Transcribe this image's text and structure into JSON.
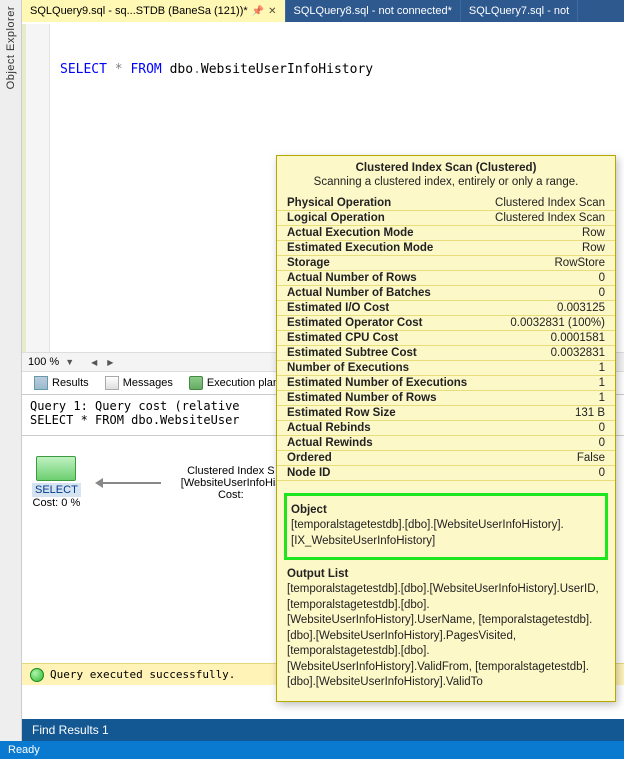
{
  "sidebar": {
    "object_explorer": "Object Explorer"
  },
  "tabs": [
    {
      "label": "SQLQuery9.sql - sq...STDB (BaneSa (121))*",
      "active": true
    },
    {
      "label": "SQLQuery8.sql - not connected*",
      "active": false
    },
    {
      "label": "SQLQuery7.sql - not",
      "active": false
    }
  ],
  "sql": {
    "select": "SELECT",
    "star": " * ",
    "from": "FROM",
    "space": " ",
    "schema": "dbo",
    "dot": ".",
    "object": "WebsiteUserInfoHistory"
  },
  "zoom": {
    "value": "100 %"
  },
  "result_tabs": {
    "results": "Results",
    "messages": "Messages",
    "plan": "Execution plan"
  },
  "plan": {
    "line1": "Query 1: Query cost (relative",
    "line2": "SELECT * FROM dbo.WebsiteUser",
    "select_label": "SELECT",
    "select_cost": "Cost: 0 %",
    "scan_l1": "Clustered Index S",
    "scan_l2": "[WebsiteUserInfoHis",
    "scan_cost": "Cost:"
  },
  "status": {
    "text": "Query executed successfully."
  },
  "find_results": "Find Results 1",
  "ready": "Ready",
  "tooltip": {
    "title": "Clustered Index Scan (Clustered)",
    "subtitle": "Scanning a clustered index, entirely or only a range.",
    "rows": [
      {
        "k": "Physical Operation",
        "v": "Clustered Index Scan"
      },
      {
        "k": "Logical Operation",
        "v": "Clustered Index Scan"
      },
      {
        "k": "Actual Execution Mode",
        "v": "Row"
      },
      {
        "k": "Estimated Execution Mode",
        "v": "Row"
      },
      {
        "k": "Storage",
        "v": "RowStore"
      },
      {
        "k": "Actual Number of Rows",
        "v": "0"
      },
      {
        "k": "Actual Number of Batches",
        "v": "0"
      },
      {
        "k": "Estimated I/O Cost",
        "v": "0.003125"
      },
      {
        "k": "Estimated Operator Cost",
        "v": "0.0032831 (100%)"
      },
      {
        "k": "Estimated CPU Cost",
        "v": "0.0001581"
      },
      {
        "k": "Estimated Subtree Cost",
        "v": "0.0032831"
      },
      {
        "k": "Number of Executions",
        "v": "1"
      },
      {
        "k": "Estimated Number of Executions",
        "v": "1"
      },
      {
        "k": "Estimated Number of Rows",
        "v": "1"
      },
      {
        "k": "Estimated Row Size",
        "v": "131 B"
      },
      {
        "k": "Actual Rebinds",
        "v": "0"
      },
      {
        "k": "Actual Rewinds",
        "v": "0"
      },
      {
        "k": "Ordered",
        "v": "False"
      },
      {
        "k": "Node ID",
        "v": "0"
      }
    ],
    "object_label": "Object",
    "object_text": "[temporalstagetestdb].[dbo].[WebsiteUserInfoHistory].[IX_WebsiteUserInfoHistory]",
    "output_label": "Output List",
    "output_text": "[temporalstagetestdb].[dbo].[WebsiteUserInfoHistory].UserID, [temporalstagetestdb].[dbo].[WebsiteUserInfoHistory].UserName, [temporalstagetestdb].[dbo].[WebsiteUserInfoHistory].PagesVisited, [temporalstagetestdb].[dbo].[WebsiteUserInfoHistory].ValidFrom, [temporalstagetestdb].[dbo].[WebsiteUserInfoHistory].ValidTo"
  }
}
